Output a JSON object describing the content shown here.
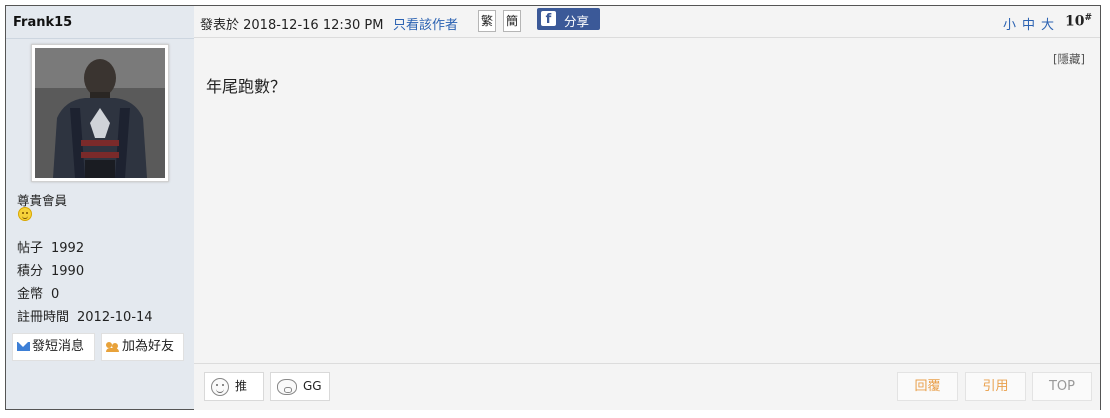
{
  "author": {
    "username": "Frank15",
    "usergroup": "尊貴會員",
    "stats": [
      {
        "label": "帖子",
        "value": "1992"
      },
      {
        "label": "積分",
        "value": "1990"
      },
      {
        "label": "金幣",
        "value": "0"
      },
      {
        "label": "註冊時間",
        "value": "2012-10-14"
      }
    ],
    "send_message_label": "發短消息",
    "add_friend_label": "加為好友"
  },
  "post": {
    "posted_at": "發表於 2018-12-16 12:30 PM",
    "author_only_label": "只看該作者",
    "traditional_label": "繁",
    "simplified_label": "簡",
    "share_label": "分享",
    "font_small": "小",
    "font_medium": "中",
    "font_large": "大",
    "floor_number": "10",
    "floor_mark": "#",
    "hide_label": "[隱藏]",
    "content": "年尾跑數？"
  },
  "actions": {
    "push_label": "推",
    "gg_label": "GG",
    "reply_label": "回覆",
    "quote_label": "引用",
    "top_label": "TOP"
  }
}
